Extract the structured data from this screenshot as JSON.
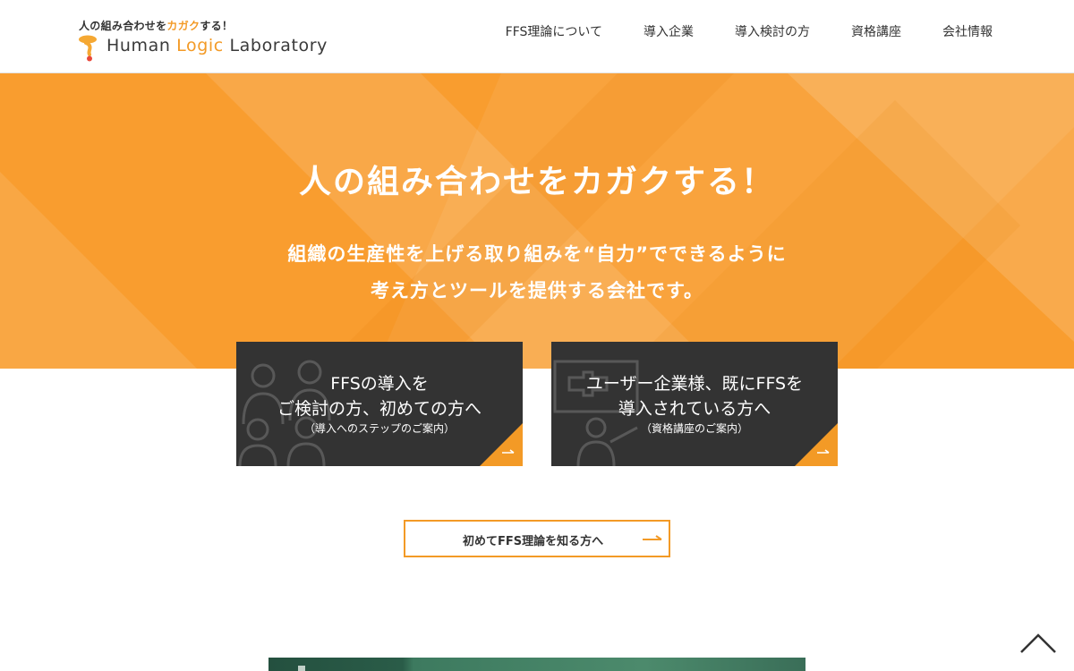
{
  "header": {
    "logo": {
      "tagline_pre": "人の組み合わせを",
      "tagline_accent": "カガク",
      "tagline_post": "する！",
      "name_1": "Human ",
      "name_accent": "Logic",
      "name_2": " Laboratory"
    },
    "nav": [
      {
        "label": "FFS理論について"
      },
      {
        "label": "導入企業"
      },
      {
        "label": "導入検討の方"
      },
      {
        "label": "資格講座"
      },
      {
        "label": "会社情報"
      }
    ]
  },
  "hero": {
    "title": "人の組み合わせをカガクする！",
    "subtitle_line1": "組織の生産性を上げる取り組みを“自力”でできるように",
    "subtitle_line2": "考え方とツールを提供する会社です。"
  },
  "cards": [
    {
      "line1": "FFSの導入を",
      "line2": "ご検討の方、初めての方へ",
      "note": "（導入へのステップのご案内）"
    },
    {
      "line1": "ユーザー企業様、既にFFSを",
      "line2": "導入されている方へ",
      "note": "（資格講座のご案内）"
    }
  ],
  "learn_button": {
    "label": "初めてFFS理論を知る方へ"
  },
  "colors": {
    "accent": "#f39a26",
    "hero_bg": "#f99d2f",
    "card_bg": "#333333",
    "banner": "#3d7a5f"
  },
  "icons": {
    "card_corner": "arrow-right-icon",
    "scroll_top": "chevron-up-icon"
  }
}
